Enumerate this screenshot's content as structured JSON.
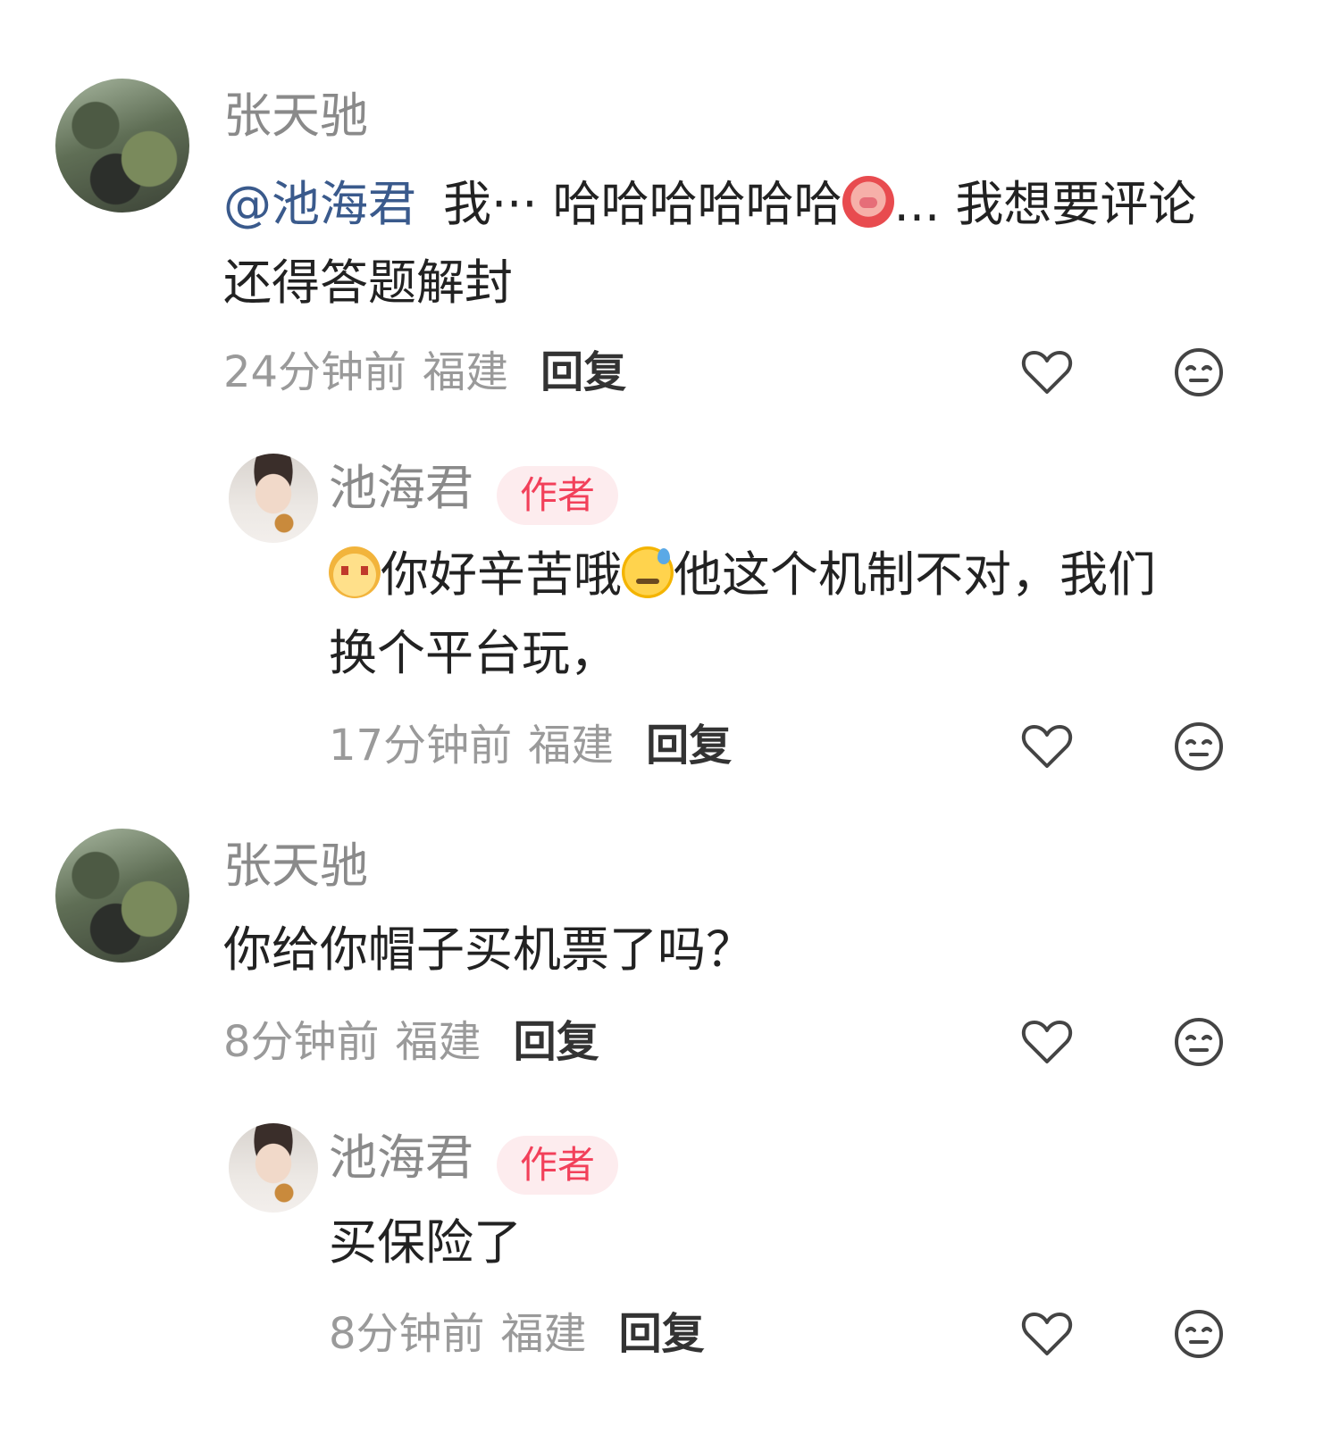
{
  "comments": [
    {
      "username": "张天驰",
      "mention": "@池海君",
      "text_1": "我··· 哈哈哈哈哈哈",
      "text_2": "... 我想要评论",
      "text_3": "还得答题解封",
      "time": "24分钟前",
      "location": "福建",
      "reply": "回复",
      "icons": [
        "heart-icon",
        "dislike-face-icon"
      ]
    },
    {
      "username": "池海君",
      "badge": "作者",
      "text_1": "你好辛苦哦",
      "text_2": "他这个机制不对，我们",
      "text_3": "换个平台玩，",
      "time": "17分钟前",
      "location": "福建",
      "reply": "回复",
      "icons": [
        "heart-icon",
        "dislike-face-icon"
      ]
    },
    {
      "username": "张天驰",
      "text_1": "你给你帽子买机票了吗？",
      "time": "8分钟前",
      "location": "福建",
      "reply": "回复",
      "icons": [
        "heart-icon",
        "dislike-face-icon"
      ]
    },
    {
      "username": "池海君",
      "badge": "作者",
      "text_1": "买保险了",
      "time": "8分钟前",
      "location": "福建",
      "reply": "回复",
      "icons": [
        "heart-icon",
        "dislike-face-icon"
      ]
    }
  ]
}
